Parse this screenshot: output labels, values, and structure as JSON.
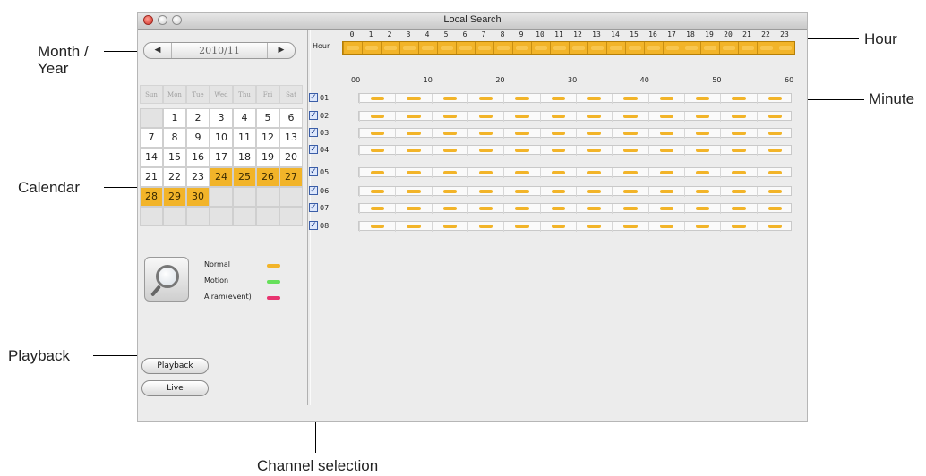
{
  "window": {
    "title": "Local Search"
  },
  "callouts": {
    "month_year": "Month /\nYear",
    "calendar": "Calendar",
    "playback": "Playback",
    "hour": "Hour",
    "minute": "Minute",
    "channel_selection": "Channel selection"
  },
  "month_nav": {
    "prev_icon": "prev-arrow-icon",
    "next_icon": "next-arrow-icon",
    "value": "2010/11"
  },
  "calendar": {
    "weekdays": [
      "Sun",
      "Mon",
      "Tue",
      "Wed",
      "Thu",
      "Fri",
      "Sat"
    ],
    "weeks": [
      [
        "",
        "1",
        "2",
        "3",
        "4",
        "5",
        "6"
      ],
      [
        "7",
        "8",
        "9",
        "10",
        "11",
        "12",
        "13"
      ],
      [
        "14",
        "15",
        "16",
        "17",
        "18",
        "19",
        "20"
      ],
      [
        "21",
        "22",
        "23",
        "24",
        "25",
        "26",
        "27"
      ],
      [
        "28",
        "29",
        "30",
        "",
        "",
        "",
        ""
      ],
      [
        "",
        "",
        "",
        "",
        "",
        "",
        ""
      ]
    ],
    "recorded_days": [
      "24",
      "25",
      "26",
      "27",
      "28",
      "29",
      "30"
    ],
    "recorded_color": "#f2b429"
  },
  "legend": [
    {
      "label": "Normal",
      "color": "#f2b429"
    },
    {
      "label": "Motion",
      "color": "#66e05a"
    },
    {
      "label": "Alram(event)",
      "color": "#e8346f"
    }
  ],
  "buttons": {
    "playback": "Playback",
    "live": "Live"
  },
  "timeline": {
    "hour_label": "Hour",
    "hours": [
      "0",
      "1",
      "2",
      "3",
      "4",
      "5",
      "6",
      "7",
      "8",
      "9",
      "10",
      "11",
      "12",
      "13",
      "14",
      "15",
      "16",
      "17",
      "18",
      "19",
      "20",
      "21",
      "22",
      "23"
    ],
    "minute_ticks": [
      "00",
      "10",
      "20",
      "30",
      "40",
      "50",
      "60"
    ],
    "channels": [
      {
        "label": "01",
        "checked": true
      },
      {
        "label": "02",
        "checked": true
      },
      {
        "label": "03",
        "checked": true
      },
      {
        "label": "04",
        "checked": true
      },
      {
        "label": "05",
        "checked": true
      },
      {
        "label": "06",
        "checked": true
      },
      {
        "label": "07",
        "checked": true
      },
      {
        "label": "08",
        "checked": true
      }
    ]
  }
}
